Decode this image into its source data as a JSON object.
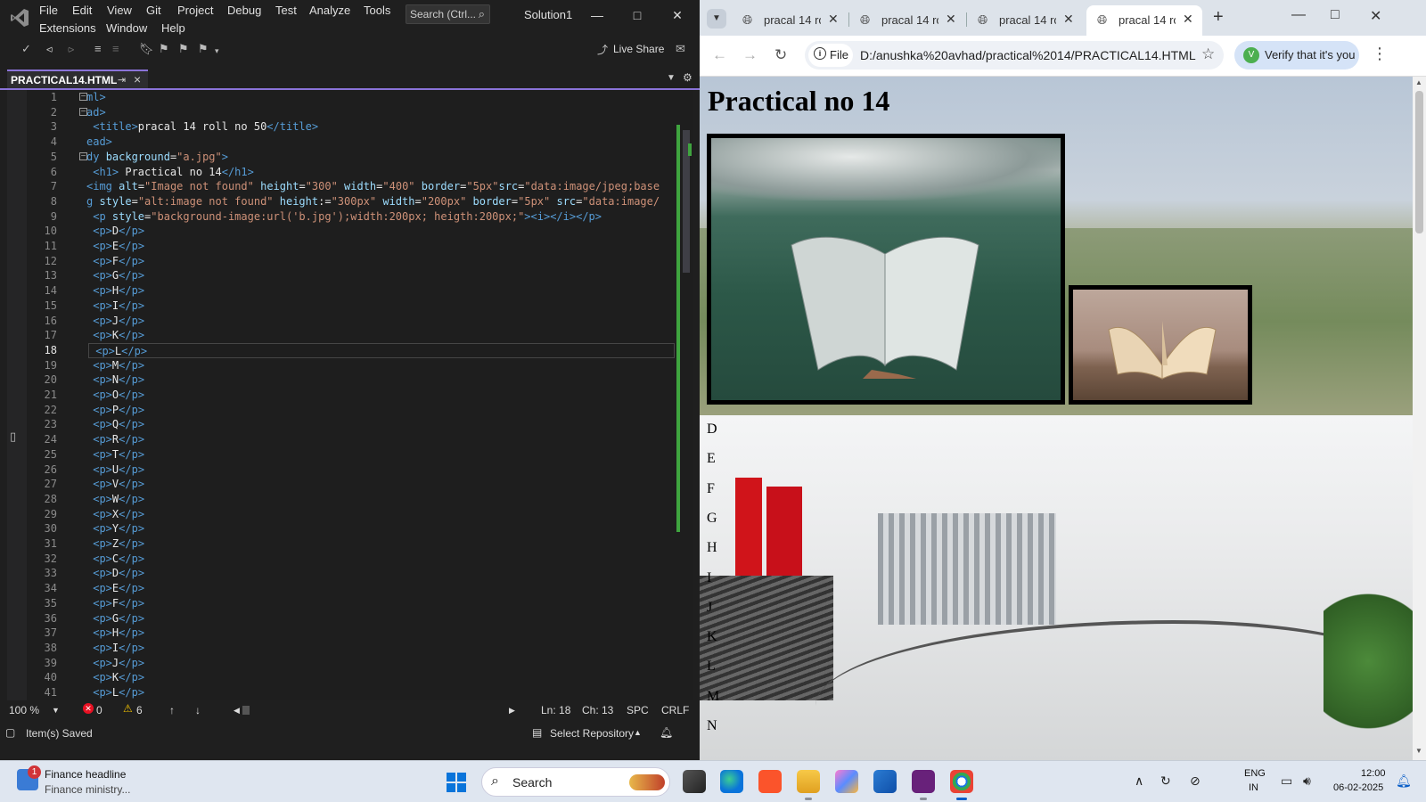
{
  "vs": {
    "menu_row1": [
      "File",
      "Edit",
      "View",
      "Git",
      "Project",
      "Debug",
      "Test",
      "Analyze",
      "Tools"
    ],
    "menu_row2": [
      "Extensions",
      "Window",
      "Help"
    ],
    "search_placeholder": "Search (Ctrl...",
    "solution_name": "Solution1",
    "live_share": "Live Share",
    "file_tab": "PRACTICAL14.HTML",
    "current_line": 18,
    "code_lines": [
      [
        [
          "tg",
          "ml>"
        ]
      ],
      [
        [
          "tg",
          "ad>"
        ]
      ],
      [
        [
          "tg",
          " <title>"
        ],
        [
          "tx",
          "pracal 14 roll no 50"
        ],
        [
          "tg",
          "</title>"
        ]
      ],
      [
        [
          "tg",
          "ead>"
        ]
      ],
      [
        [
          "tg",
          "dy "
        ],
        [
          "at",
          "background"
        ],
        [
          "tx",
          "="
        ],
        [
          "st",
          "\"a.jpg\""
        ],
        [
          "tg",
          ">"
        ]
      ],
      [
        [
          "tg",
          " <h1>"
        ],
        [
          "tx",
          " Practical no 14"
        ],
        [
          "tg",
          "</h1>"
        ]
      ],
      [
        [
          "tg",
          "<img "
        ],
        [
          "at",
          "alt"
        ],
        [
          "tx",
          "="
        ],
        [
          "st",
          "\"Image not found\""
        ],
        [
          "at",
          " height"
        ],
        [
          "tx",
          "="
        ],
        [
          "st",
          "\"300\""
        ],
        [
          "at",
          " width"
        ],
        [
          "tx",
          "="
        ],
        [
          "st",
          "\"400\""
        ],
        [
          "at",
          " border"
        ],
        [
          "tx",
          "="
        ],
        [
          "st",
          "\"5px\""
        ],
        [
          "at",
          "src"
        ],
        [
          "tx",
          "="
        ],
        [
          "st",
          "\"data:image/jpeg;base"
        ]
      ],
      [
        [
          "tg",
          "g "
        ],
        [
          "at",
          "style"
        ],
        [
          "tx",
          "="
        ],
        [
          "st",
          "\"alt:image not found\""
        ],
        [
          "at",
          " height"
        ],
        [
          "tx",
          ":="
        ],
        [
          "st",
          "\"300px\""
        ],
        [
          "at",
          " width"
        ],
        [
          "tx",
          "="
        ],
        [
          "st",
          "\"200px\""
        ],
        [
          "at",
          " border"
        ],
        [
          "tx",
          "="
        ],
        [
          "st",
          "\"5px\""
        ],
        [
          "at",
          " src"
        ],
        [
          "tx",
          "="
        ],
        [
          "st",
          "\"data:image/"
        ]
      ],
      [
        [
          "tg",
          " <p "
        ],
        [
          "at",
          "style"
        ],
        [
          "tx",
          "="
        ],
        [
          "st",
          "\"background-image:url('b.jpg');width:200px; heigth:200px;\""
        ],
        [
          "tg",
          "><i></i></p>"
        ]
      ],
      [
        [
          "tg",
          " <p>"
        ],
        [
          "tx",
          "D"
        ],
        [
          "tg",
          "</p>"
        ]
      ],
      [
        [
          "tg",
          " <p>"
        ],
        [
          "tx",
          "E"
        ],
        [
          "tg",
          "</p>"
        ]
      ],
      [
        [
          "tg",
          " <p>"
        ],
        [
          "tx",
          "F"
        ],
        [
          "tg",
          "</p>"
        ]
      ],
      [
        [
          "tg",
          " <p>"
        ],
        [
          "tx",
          "G"
        ],
        [
          "tg",
          "</p>"
        ]
      ],
      [
        [
          "tg",
          " <p>"
        ],
        [
          "tx",
          "H"
        ],
        [
          "tg",
          "</p>"
        ]
      ],
      [
        [
          "tg",
          " <p>"
        ],
        [
          "tx",
          "I"
        ],
        [
          "tg",
          "</p>"
        ]
      ],
      [
        [
          "tg",
          " <p>"
        ],
        [
          "tx",
          "J"
        ],
        [
          "tg",
          "</p>"
        ]
      ],
      [
        [
          "tg",
          " <p>"
        ],
        [
          "tx",
          "K"
        ],
        [
          "tg",
          "</p>"
        ]
      ],
      [
        [
          "tg",
          " <p>"
        ],
        [
          "tx",
          "L"
        ],
        [
          "tg",
          "</p>"
        ]
      ],
      [
        [
          "tg",
          " <p>"
        ],
        [
          "tx",
          "M"
        ],
        [
          "tg",
          "</p>"
        ]
      ],
      [
        [
          "tg",
          " <p>"
        ],
        [
          "tx",
          "N"
        ],
        [
          "tg",
          "</p>"
        ]
      ],
      [
        [
          "tg",
          " <p>"
        ],
        [
          "tx",
          "O"
        ],
        [
          "tg",
          "</p>"
        ]
      ],
      [
        [
          "tg",
          " <p>"
        ],
        [
          "tx",
          "P"
        ],
        [
          "tg",
          "</p>"
        ]
      ],
      [
        [
          "tg",
          " <p>"
        ],
        [
          "tx",
          "Q"
        ],
        [
          "tg",
          "</p>"
        ]
      ],
      [
        [
          "tg",
          " <p>"
        ],
        [
          "tx",
          "R"
        ],
        [
          "tg",
          "</p>"
        ]
      ],
      [
        [
          "tg",
          " <p>"
        ],
        [
          "tx",
          "T"
        ],
        [
          "tg",
          "</p>"
        ]
      ],
      [
        [
          "tg",
          " <p>"
        ],
        [
          "tx",
          "U"
        ],
        [
          "tg",
          "</p>"
        ]
      ],
      [
        [
          "tg",
          " <p>"
        ],
        [
          "tx",
          "V"
        ],
        [
          "tg",
          "</p>"
        ]
      ],
      [
        [
          "tg",
          " <p>"
        ],
        [
          "tx",
          "W"
        ],
        [
          "tg",
          "</p>"
        ]
      ],
      [
        [
          "tg",
          " <p>"
        ],
        [
          "tx",
          "X"
        ],
        [
          "tg",
          "</p>"
        ]
      ],
      [
        [
          "tg",
          " <p>"
        ],
        [
          "tx",
          "Y"
        ],
        [
          "tg",
          "</p>"
        ]
      ],
      [
        [
          "tg",
          " <p>"
        ],
        [
          "tx",
          "Z"
        ],
        [
          "tg",
          "</p>"
        ]
      ],
      [
        [
          "tg",
          " <p>"
        ],
        [
          "tx",
          "C"
        ],
        [
          "tg",
          "</p>"
        ]
      ],
      [
        [
          "tg",
          " <p>"
        ],
        [
          "tx",
          "D"
        ],
        [
          "tg",
          "</p>"
        ]
      ],
      [
        [
          "tg",
          " <p>"
        ],
        [
          "tx",
          "E"
        ],
        [
          "tg",
          "</p>"
        ]
      ],
      [
        [
          "tg",
          " <p>"
        ],
        [
          "tx",
          "F"
        ],
        [
          "tg",
          "</p>"
        ]
      ],
      [
        [
          "tg",
          " <p>"
        ],
        [
          "tx",
          "G"
        ],
        [
          "tg",
          "</p>"
        ]
      ],
      [
        [
          "tg",
          " <p>"
        ],
        [
          "tx",
          "H"
        ],
        [
          "tg",
          "</p>"
        ]
      ],
      [
        [
          "tg",
          " <p>"
        ],
        [
          "tx",
          "I"
        ],
        [
          "tg",
          "</p>"
        ]
      ],
      [
        [
          "tg",
          " <p>"
        ],
        [
          "tx",
          "J"
        ],
        [
          "tg",
          "</p>"
        ]
      ],
      [
        [
          "tg",
          " <p>"
        ],
        [
          "tx",
          "K"
        ],
        [
          "tg",
          "</p>"
        ]
      ],
      [
        [
          "tg",
          " <p>"
        ],
        [
          "tx",
          "L"
        ],
        [
          "tg",
          "</p>"
        ]
      ]
    ],
    "status": {
      "zoom": "100 %",
      "errors": "0",
      "warnings": "6",
      "ln": "Ln: 18",
      "ch": "Ch: 13",
      "spc": "SPC",
      "crlf": "CRLF",
      "saved": "Item(s) Saved",
      "repo": "Select Repository"
    }
  },
  "chrome": {
    "tabs": [
      "pracal 14 ro",
      "pracal 14 ro",
      "pracal 14 ro",
      "pracal 14 ro"
    ],
    "active_tab": 3,
    "url_chip": "File",
    "url": "D:/anushka%20avhad/practical%2014/PRACTICAL14.HTML",
    "verify": "Verify that it's you",
    "avatar_letter": "V",
    "page": {
      "heading": "Practical no 14",
      "letters": [
        "D",
        "E",
        "F",
        "G",
        "H",
        "I",
        "J",
        "K",
        "L",
        "M",
        "N"
      ]
    }
  },
  "taskbar": {
    "news_title": "Finance headline",
    "news_sub": "Finance ministry...",
    "news_badge": "1",
    "search": "Search",
    "lang1": "ENG",
    "lang2": "IN",
    "time": "12:00",
    "date": "06-02-2025"
  }
}
